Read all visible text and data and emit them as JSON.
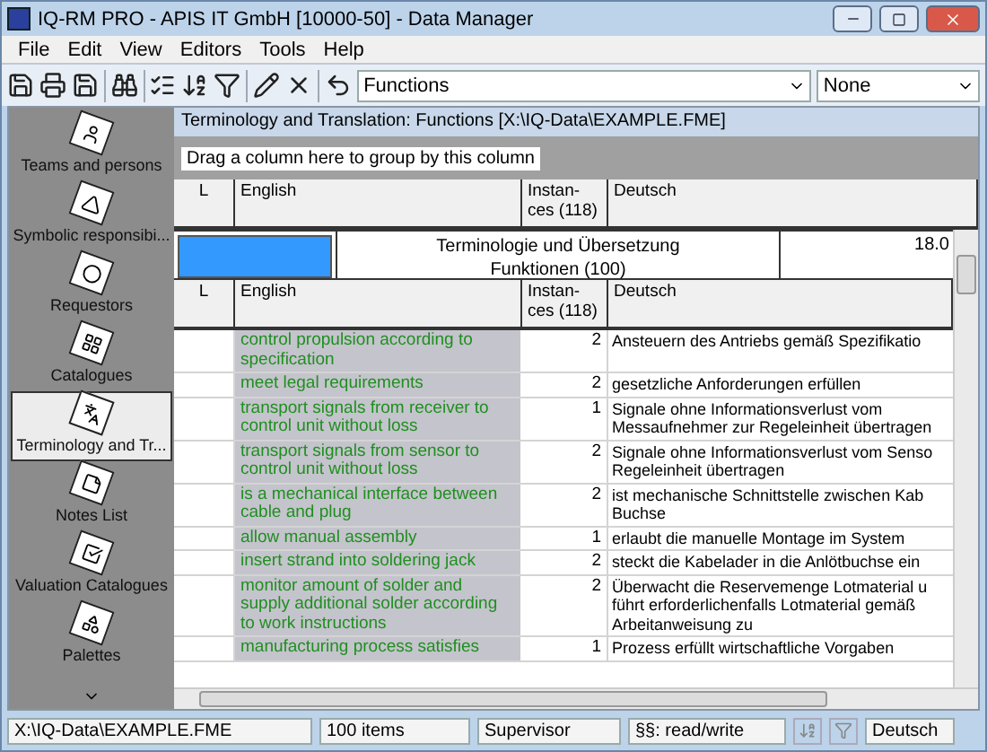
{
  "window": {
    "title": "IQ-RM PRO - APIS IT GmbH [10000-50] - Data Manager"
  },
  "menu": [
    "File",
    "Edit",
    "View",
    "Editors",
    "Tools",
    "Help"
  ],
  "toolbar": {
    "view_select": "Functions",
    "filter_select": "None"
  },
  "sidebar": {
    "items": [
      {
        "label": "Teams and persons",
        "selected": false
      },
      {
        "label": "Symbolic responsibi...",
        "selected": false
      },
      {
        "label": "Requestors",
        "selected": false
      },
      {
        "label": "Catalogues",
        "selected": false
      },
      {
        "label": "Terminology and Tr...",
        "selected": true
      },
      {
        "label": "Notes List",
        "selected": false
      },
      {
        "label": "Valuation Catalogues",
        "selected": false
      },
      {
        "label": "Palettes",
        "selected": false
      }
    ]
  },
  "panel": {
    "title": "Terminology and Translation: Functions [X:\\IQ-Data\\EXAMPLE.FME]",
    "group_hint": "Drag a column here to group by this column"
  },
  "table": {
    "columns": [
      "L",
      "English",
      "Instan-\nces (118)",
      "Deutsch"
    ],
    "group": {
      "title": "Terminologie und Übersetzung",
      "subtitle": "Funktionen (100)",
      "value": "18.0"
    },
    "inner_columns": [
      "L",
      "English",
      "Instan-\nces (118)",
      "Deutsch"
    ],
    "rows": [
      {
        "english": "control propulsion according to specification",
        "instances": "2",
        "deutsch": "Ansteuern des Antriebs gemäß Spezifikatio"
      },
      {
        "english": "meet legal requirements",
        "instances": "2",
        "deutsch": "gesetzliche Anforderungen erfüllen"
      },
      {
        "english": "transport signals from receiver to control unit without loss",
        "instances": "1",
        "deutsch": "Signale ohne Informationsverlust vom\nMessaufnehmer zur Regeleinheit übertragen"
      },
      {
        "english": "transport signals from sensor to control unit without loss",
        "instances": "2",
        "deutsch": "Signale ohne Informationsverlust vom Senso\nRegeleinheit übertragen"
      },
      {
        "english": "is a mechanical interface between cable and plug",
        "instances": "2",
        "deutsch": "ist mechanische Schnittstelle zwischen Kab\nBuchse"
      },
      {
        "english": "allow manual assembly",
        "instances": "1",
        "deutsch": "erlaubt die manuelle Montage im System"
      },
      {
        "english": "insert strand into soldering jack",
        "instances": "2",
        "deutsch": "steckt die Kabelader in die Anlötbuchse ein"
      },
      {
        "english": "monitor amount of solder and supply additional solder according to work instructions",
        "instances": "2",
        "deutsch": "Überwacht die Reservemenge Lotmaterial u\nführt erforderlichenfalls Lotmaterial gemäß\nArbeitanweisung zu"
      },
      {
        "english": "manufacturing process satisfies",
        "instances": "1",
        "deutsch": "Prozess erfüllt wirtschaftliche Vorgaben"
      }
    ]
  },
  "status_bar": {
    "file": "X:\\IQ-Data\\EXAMPLE.FME",
    "count": "100 items",
    "user": "Supervisor",
    "rights": "§§: read/write",
    "language": "Deutsch"
  }
}
